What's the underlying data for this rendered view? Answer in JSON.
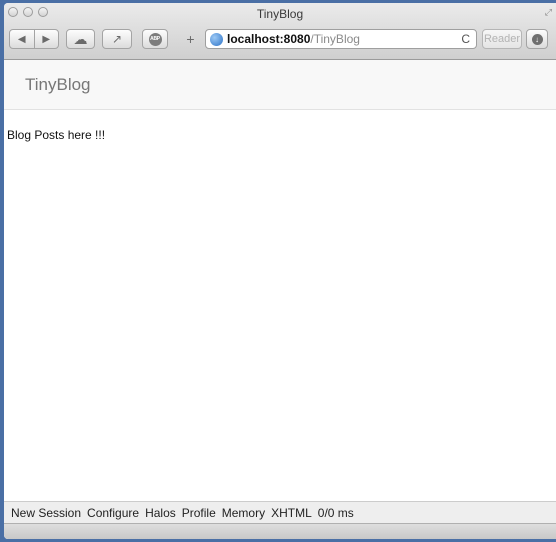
{
  "window": {
    "title": "TinyBlog"
  },
  "toolbar": {
    "back_icon": "◀",
    "forward_icon": "▶",
    "cloud_icon": "☁",
    "share_icon": "↗",
    "adblock_label": "ABP",
    "new_tab_icon": "+",
    "reload_icon": "C",
    "reader_label": "Reader",
    "downloads_icon": "↓"
  },
  "address_bar": {
    "host": "localhost:8080",
    "path": "/TinyBlog"
  },
  "app": {
    "brand": "TinyBlog",
    "content_text": "Blog Posts here !!!"
  },
  "dev_toolbar": {
    "items": [
      "New Session",
      "Configure",
      "Halos",
      "Profile",
      "Memory",
      "XHTML"
    ],
    "timing": "0/0 ms"
  }
}
